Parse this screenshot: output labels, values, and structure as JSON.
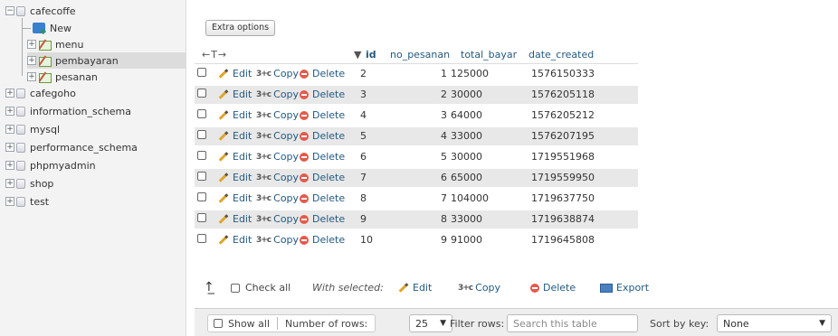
{
  "nav": {
    "databases": [
      {
        "label": "cafecoffe",
        "expanded": true
      },
      {
        "label": "cafegoho",
        "expanded": false
      },
      {
        "label": "information_schema",
        "expanded": false
      },
      {
        "label": "mysql",
        "expanded": false
      },
      {
        "label": "performance_schema",
        "expanded": false
      },
      {
        "label": "phpmyadmin",
        "expanded": false
      },
      {
        "label": "shop",
        "expanded": false
      },
      {
        "label": "test",
        "expanded": false
      }
    ],
    "cafecoffe_children": [
      "New",
      "menu",
      "pembayaran",
      "pesanan"
    ]
  },
  "toolbar": {
    "extra_options": "Extra options"
  },
  "table": {
    "sort_arrows": "←T→",
    "sort_indicator": "▼",
    "columns": [
      "id",
      "no_pesanan",
      "total_bayar",
      "date_created"
    ],
    "actions": {
      "edit": "Edit",
      "copy": "Copy",
      "delete": "Delete"
    },
    "rows": [
      {
        "id": "2",
        "no_pesanan": "1",
        "total_bayar": "125000",
        "date_created": "1576150333"
      },
      {
        "id": "3",
        "no_pesanan": "2",
        "total_bayar": "30000",
        "date_created": "1576205118"
      },
      {
        "id": "4",
        "no_pesanan": "3",
        "total_bayar": "64000",
        "date_created": "1576205212"
      },
      {
        "id": "5",
        "no_pesanan": "4",
        "total_bayar": "33000",
        "date_created": "1576207195"
      },
      {
        "id": "6",
        "no_pesanan": "5",
        "total_bayar": "30000",
        "date_created": "1719551968"
      },
      {
        "id": "7",
        "no_pesanan": "6",
        "total_bayar": "65000",
        "date_created": "1719559950"
      },
      {
        "id": "8",
        "no_pesanan": "7",
        "total_bayar": "104000",
        "date_created": "1719637750"
      },
      {
        "id": "9",
        "no_pesanan": "8",
        "total_bayar": "33000",
        "date_created": "1719638874"
      },
      {
        "id": "10",
        "no_pesanan": "9",
        "total_bayar": "91000",
        "date_created": "1719645808"
      }
    ]
  },
  "bulk": {
    "check_all": "Check all",
    "with_selected": "With selected:",
    "edit": "Edit",
    "copy": "Copy",
    "delete": "Delete",
    "export": "Export"
  },
  "footer": {
    "show_all": "Show all",
    "number_of_rows_label": "Number of rows:",
    "number_of_rows_value": "25",
    "filter_rows_label": "Filter rows:",
    "search_placeholder": "Search this table",
    "sort_by_key_label": "Sort by key:",
    "sort_by_key_value": "None"
  },
  "colors": {
    "link": "#235a81",
    "row_alt": "#e8e8e8",
    "delete": "#e25b4a"
  }
}
